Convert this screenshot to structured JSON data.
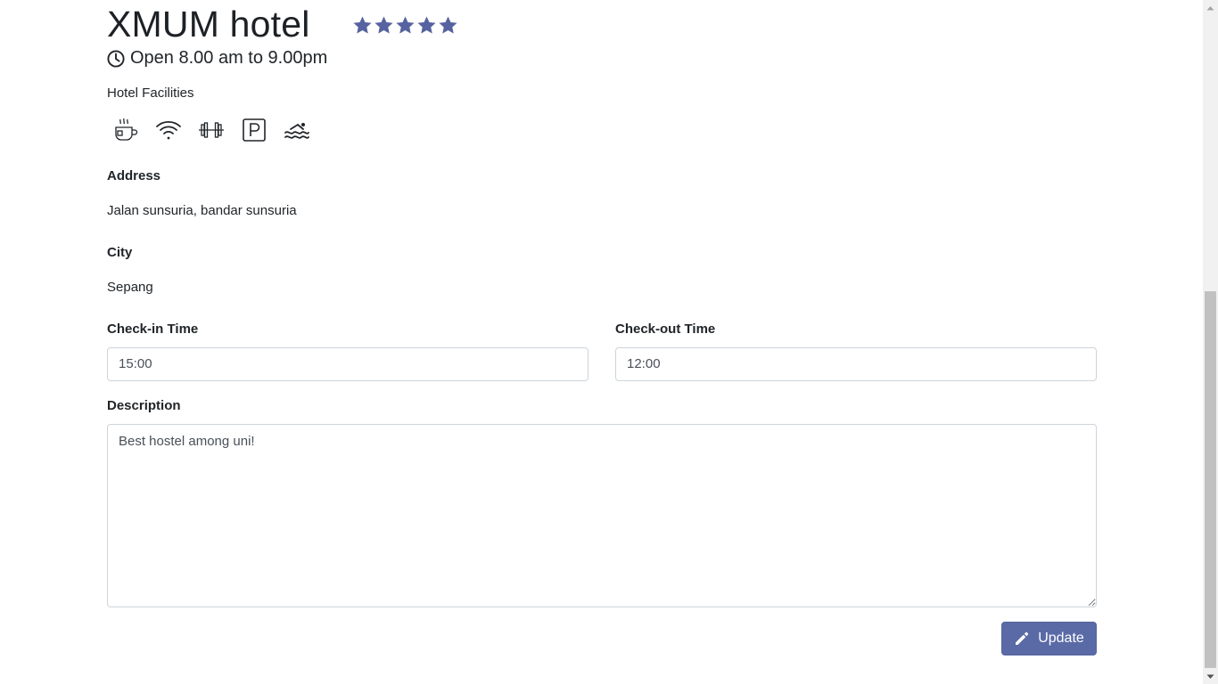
{
  "hotel": {
    "name": "XMUM hotel",
    "rating": 5,
    "rating_max": 5,
    "star_color": "#5663a0",
    "hours": "Open 8.00 am to 9.00pm"
  },
  "facilities": {
    "label": "Hotel Facilities",
    "icons": [
      "cafe-icon",
      "wifi-icon",
      "gym-icon",
      "parking-icon",
      "swimming-pool-icon"
    ]
  },
  "address": {
    "label": "Address",
    "value": "Jalan sunsuria, bandar sunsuria"
  },
  "city": {
    "label": "City",
    "value": "Sepang"
  },
  "checkin": {
    "label": "Check-in Time",
    "value": "15:00"
  },
  "checkout": {
    "label": "Check-out Time",
    "value": "12:00"
  },
  "description": {
    "label": "Description",
    "value": "Best hostel among uni!"
  },
  "actions": {
    "update_label": "Update",
    "update_color": "#5a6aa6"
  }
}
